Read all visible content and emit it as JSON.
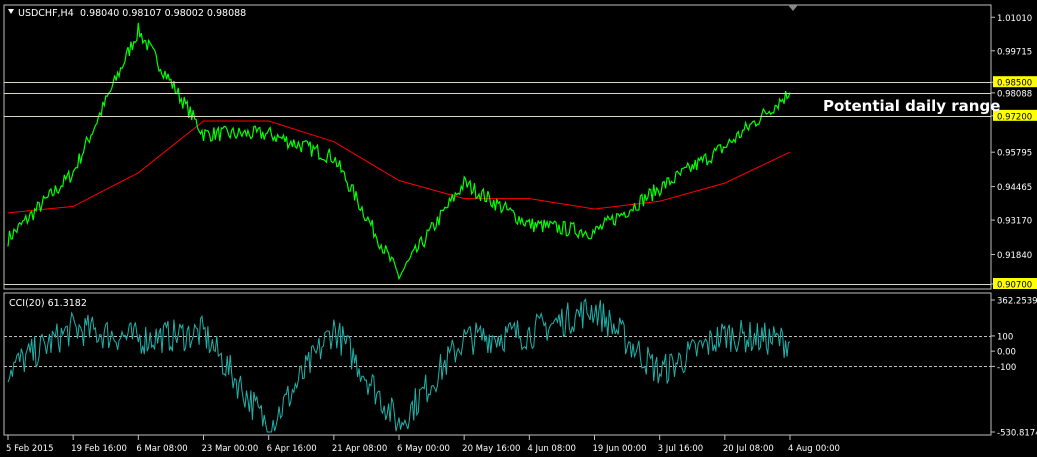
{
  "main_header": {
    "collapse_icon": "triangle-down-icon",
    "symbol": "USDCHF,H4",
    "ohlc": "0.98040 0.98107 0.98002 0.98088"
  },
  "annotation": "Potential daily range",
  "price_axis": {
    "ticks": [
      "1.01010",
      "0.99715",
      "0.98500",
      "0.98088",
      "0.97200",
      "0.95795",
      "0.94465",
      "0.93170",
      "0.91840",
      "0.90700"
    ],
    "highlighted": [
      "0.98500",
      "0.97200",
      "0.90700"
    ],
    "current": "0.98088"
  },
  "cci_header": "CCI(20) 61.3182",
  "cci_axis": {
    "ticks": [
      "362.2539",
      "100",
      "0.00",
      "-100",
      "-530.8174"
    ]
  },
  "time_axis": {
    "labels": [
      "5 Feb 2015",
      "19 Feb 16:00",
      "6 Mar 08:00",
      "23 Mar 00:00",
      "6 Apr 16:00",
      "21 Apr 08:00",
      "6 May 00:00",
      "20 May 16:00",
      "4 Jun 08:00",
      "19 Jun 00:00",
      "3 Jul 16:00",
      "20 Jul 08:00",
      "4 Aug 00:00"
    ]
  },
  "colors": {
    "background": "#000000",
    "price": "#00ff00",
    "moving_average": "#ff0000",
    "range_lines": "#d8d8c0",
    "label_bg": "#ffff00",
    "cci": "#20b2aa",
    "frame": "#c0c0c0"
  },
  "chart_data": [
    {
      "type": "line",
      "title": "USDCHF,H4",
      "series": [
        {
          "name": "USDCHF,H4",
          "x": [
            "5 Feb 2015",
            "19 Feb 16:00",
            "6 Mar 08:00",
            "23 Mar 00:00",
            "6 Apr 16:00",
            "21 Apr 08:00",
            "6 May 00:00",
            "20 May 16:00",
            "4 Jun 08:00",
            "19 Jun 00:00",
            "3 Jul 16:00",
            "20 Jul 08:00",
            "4 Aug 00:00"
          ],
          "values": [
            0.9245,
            0.95,
            1.005,
            0.965,
            0.965,
            0.956,
            0.91,
            0.946,
            0.93,
            0.927,
            0.944,
            0.96,
            0.981
          ]
        },
        {
          "x": [
            "5 Feb 2015",
            "19 Feb 16:00",
            "6 Mar 08:00",
            "23 Mar 00:00",
            "6 Apr 16:00",
            "21 Apr 08:00",
            "6 May 00:00",
            "20 May 16:00",
            "4 Jun 08:00",
            "19 Jun 00:00",
            "3 Jul 16:00",
            "20 Jul 08:00",
            "4 Aug 00:00"
          ],
          "values": [
            0.9345,
            0.937,
            0.95,
            0.97,
            0.97,
            0.962,
            0.947,
            0.94,
            0.94,
            0.936,
            0.939,
            0.946,
            0.958
          ]
        }
      ],
      "horizontal_lines": [
        0.985,
        0.98088,
        0.972,
        0.907
      ],
      "ylim": [
        0.907,
        1.016
      ]
    },
    {
      "type": "line",
      "title": "CCI(20) 61.3182",
      "series": [
        {
          "name": "CCI(20)",
          "x": [
            "5 Feb 2015",
            "19 Feb 16:00",
            "6 Mar 08:00",
            "23 Mar 00:00",
            "6 Apr 16:00",
            "21 Apr 08:00",
            "6 May 00:00",
            "20 May 16:00",
            "4 Jun 08:00",
            "19 Jun 00:00",
            "3 Jul 16:00",
            "20 Jul 08:00",
            "4 Aug 00:00"
          ],
          "values": [
            -120,
            150,
            80,
            120,
            -500,
            150,
            -480,
            80,
            120,
            280,
            -140,
            110,
            61.3182
          ]
        }
      ],
      "levels": [
        100,
        0,
        -100
      ],
      "ylim": [
        -530.8174,
        362.2539
      ]
    }
  ]
}
